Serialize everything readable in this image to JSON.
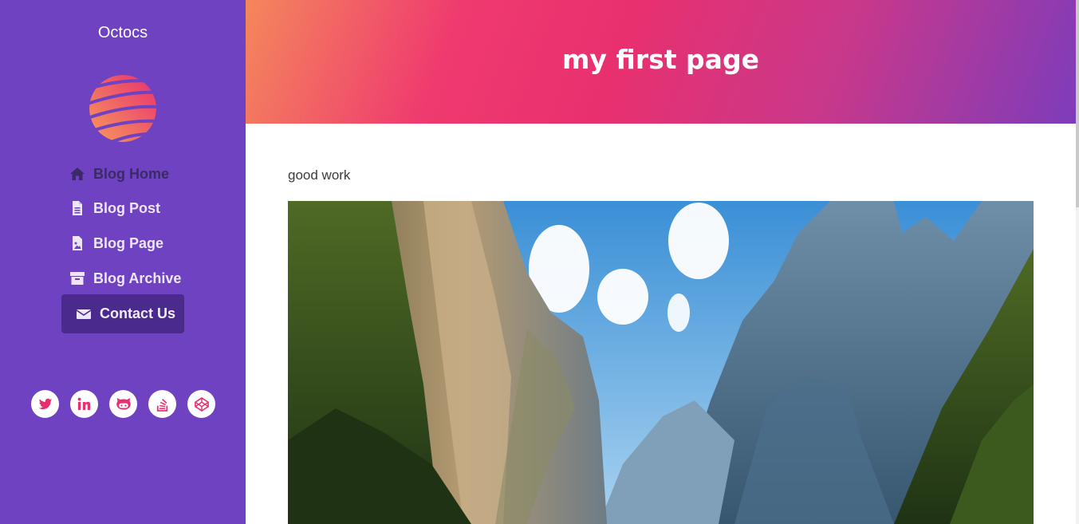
{
  "sidebar": {
    "site_title": "Octocs",
    "nav": [
      {
        "label": "Blog Home",
        "icon": "home-icon"
      },
      {
        "label": "Blog Post",
        "icon": "file-icon"
      },
      {
        "label": "Blog Page",
        "icon": "file-image-icon"
      },
      {
        "label": "Blog Archive",
        "icon": "archive-icon"
      },
      {
        "label": "Contact Us",
        "icon": "envelope-icon",
        "active": true
      }
    ],
    "socials": [
      "twitter-icon",
      "linkedin-icon",
      "github-icon",
      "stackoverflow-icon",
      "codepen-icon"
    ]
  },
  "header": {
    "title": "my first page"
  },
  "main": {
    "text": "good work",
    "image": "mountain-landscape-image"
  },
  "colors": {
    "sidebar_bg": "#6f42c1",
    "active_nav_bg": "#4a2a8c",
    "social_icon": "#e8306f",
    "header_gradient": [
      "#f4875c",
      "#ef3a6f",
      "#7d3cbb"
    ]
  }
}
